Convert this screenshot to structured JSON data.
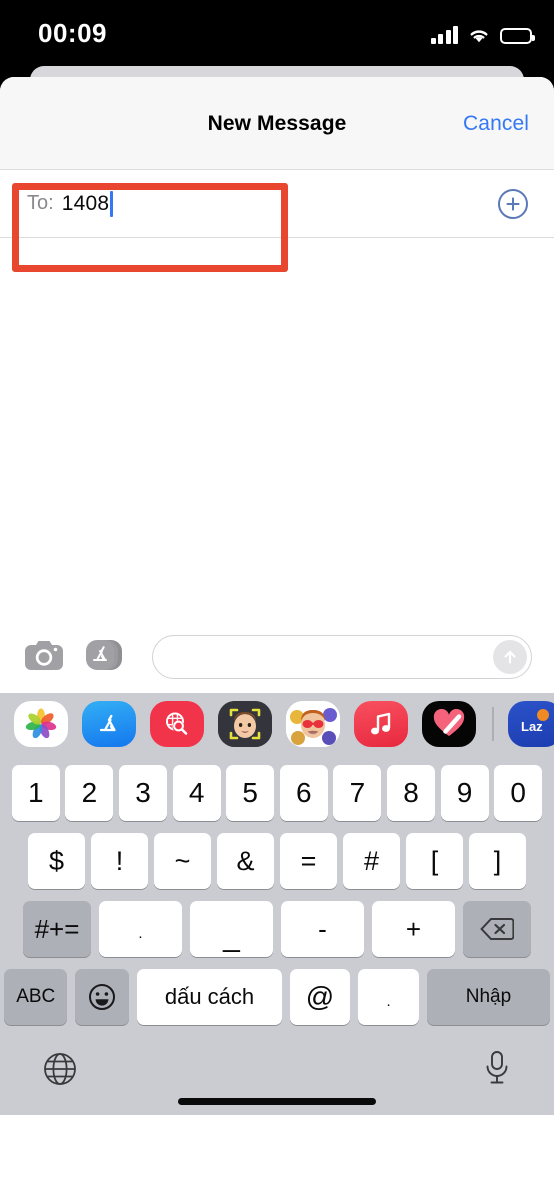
{
  "status_bar": {
    "time": "00:09",
    "signal_icon": "cellular-bars-icon",
    "wifi_icon": "wifi-icon",
    "battery_icon": "battery-low-icon",
    "battery_color": "#F5C518"
  },
  "nav": {
    "title": "New Message",
    "cancel_label": "Cancel",
    "cancel_color": "#3478F6"
  },
  "recipient_field": {
    "label": "To:",
    "value": "1408",
    "add_contact_icon": "plus-circle-icon",
    "caret_color": "#3478F6"
  },
  "annotation": {
    "color": "#E8462F",
    "target": "recipient-field"
  },
  "input_bar": {
    "camera_icon": "camera-icon",
    "apps_icon": "app-store-icon",
    "message_placeholder": "",
    "message_value": "",
    "send_icon": "send-arrow-up-icon"
  },
  "app_drawer": {
    "items": [
      {
        "name": "photos-app-icon",
        "label": "Photos"
      },
      {
        "name": "app-store-app-icon",
        "label": "App Store"
      },
      {
        "name": "images-search-app-icon",
        "label": "#images"
      },
      {
        "name": "memoji-app-icon",
        "label": "Memoji"
      },
      {
        "name": "memoji-stickers-app-icon",
        "label": "Memoji Stickers"
      },
      {
        "name": "music-app-icon",
        "label": "Music"
      },
      {
        "name": "fitness-app-icon",
        "label": "Fitness"
      },
      {
        "name": "lazada-app-icon",
        "label": "Lazada"
      }
    ]
  },
  "keyboard": {
    "layout": "numeric-symbols",
    "row1": [
      "1",
      "2",
      "3",
      "4",
      "5",
      "6",
      "7",
      "8",
      "9",
      "0"
    ],
    "row2": [
      "$",
      "!",
      "~",
      "&",
      "=",
      "#",
      "[",
      "]"
    ],
    "row3": {
      "shift_label": "#+=",
      "keys": [
        ".",
        "_",
        "-",
        "+"
      ],
      "backspace_icon": "backspace-icon"
    },
    "row4": {
      "abc_label": "ABC",
      "emoji_icon": "emoji-smiley-icon",
      "space_label": "dấu cách",
      "at_label": "@",
      "dot_label": ".",
      "enter_label": "Nhập"
    },
    "bottom_bar": {
      "globe_icon": "globe-icon",
      "mic_icon": "microphone-icon",
      "home_indicator": "home-indicator"
    }
  }
}
